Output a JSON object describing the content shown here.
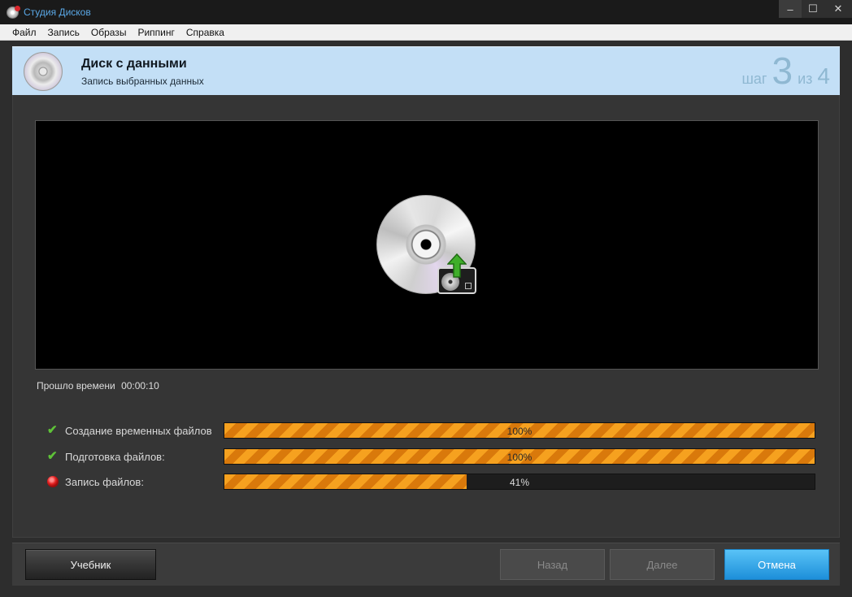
{
  "window": {
    "title": "Студия Дисков",
    "controls": {
      "minimize": "–",
      "maximize": "☐",
      "close": "✕"
    }
  },
  "menu": [
    "Файл",
    "Запись",
    "Образы",
    "Риппинг",
    "Справка"
  ],
  "header": {
    "title": "Диск с данными",
    "subtitle": "Запись выбранных данных",
    "step_word": "шаг",
    "step_current": "3",
    "step_of": "из",
    "step_total": "4"
  },
  "elapsed": {
    "label": "Прошло времени",
    "time": "00:00:10"
  },
  "tasks": [
    {
      "label": "Создание временных файлов",
      "status": "done",
      "progress": 1.0,
      "pct_label": "100%"
    },
    {
      "label": "Подготовка файлов:",
      "status": "done",
      "progress": 1.0,
      "pct_label": "100%"
    },
    {
      "label": "Запись файлов:",
      "status": "in-progress",
      "progress": 0.41,
      "pct_label": "41%"
    }
  ],
  "footer": {
    "tutorial": "Учебник",
    "back": "Назад",
    "next": "Далее",
    "cancel": "Отмена"
  },
  "colors": {
    "accent": "#2ca3ec",
    "progress": "#f6a11f",
    "header_bg": "#c3dff6"
  },
  "icons": {
    "task_done": "check-icon",
    "task_active": "red-dot-icon"
  }
}
